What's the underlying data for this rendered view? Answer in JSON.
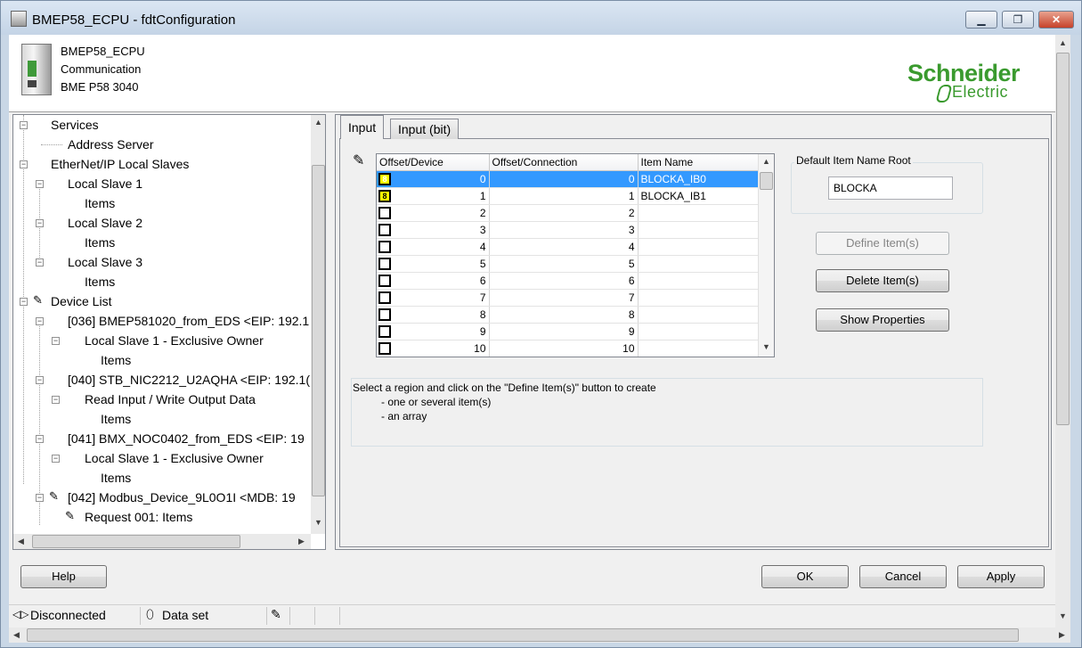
{
  "window": {
    "title": "BMEP58_ECPU - fdtConfiguration"
  },
  "header": {
    "device_name": "BMEP58_ECPU",
    "category": "Communication",
    "model": "BME P58 3040",
    "logo_line1": "Schneider",
    "logo_line2": "Electric"
  },
  "tree": {
    "items": [
      {
        "label": "Services"
      },
      {
        "label": "Address Server"
      },
      {
        "label": "EtherNet/IP Local Slaves"
      },
      {
        "label": "Local Slave 1"
      },
      {
        "label": "Items"
      },
      {
        "label": "Local Slave 2"
      },
      {
        "label": "Items"
      },
      {
        "label": "Local Slave 3"
      },
      {
        "label": "Items"
      },
      {
        "label": "Device List"
      },
      {
        "label": "[036] BMEP581020_from_EDS <EIP: 192.1"
      },
      {
        "label": "Local Slave 1 - Exclusive Owner"
      },
      {
        "label": "Items"
      },
      {
        "label": "[040] STB_NIC2212_U2AQHA <EIP: 192.1("
      },
      {
        "label": "Read Input / Write Output Data"
      },
      {
        "label": "Items"
      },
      {
        "label": "[041] BMX_NOC0402_from_EDS <EIP: 19"
      },
      {
        "label": "Local Slave 1 - Exclusive Owner"
      },
      {
        "label": "Items"
      },
      {
        "label": "[042] Modbus_Device_9L0O1I <MDB: 19"
      },
      {
        "label": "Request 001: Items"
      }
    ]
  },
  "tabs": [
    {
      "label": "Input"
    },
    {
      "label": "Input (bit)"
    }
  ],
  "grid": {
    "columns": [
      "Offset/Device",
      "Offset/Connection",
      "Item Name"
    ],
    "rows": [
      {
        "device": "0",
        "connection": "0",
        "name": "BLOCKA_IB0",
        "mark": "8"
      },
      {
        "device": "1",
        "connection": "1",
        "name": "BLOCKA_IB1",
        "mark": "8"
      },
      {
        "device": "2",
        "connection": "2",
        "name": "",
        "mark": ""
      },
      {
        "device": "3",
        "connection": "3",
        "name": "",
        "mark": ""
      },
      {
        "device": "4",
        "connection": "4",
        "name": "",
        "mark": ""
      },
      {
        "device": "5",
        "connection": "5",
        "name": "",
        "mark": ""
      },
      {
        "device": "6",
        "connection": "6",
        "name": "",
        "mark": ""
      },
      {
        "device": "7",
        "connection": "7",
        "name": "",
        "mark": ""
      },
      {
        "device": "8",
        "connection": "8",
        "name": "",
        "mark": ""
      },
      {
        "device": "9",
        "connection": "9",
        "name": "",
        "mark": ""
      },
      {
        "device": "10",
        "connection": "10",
        "name": "",
        "mark": ""
      }
    ]
  },
  "name_root": {
    "label": "Default Item Name Root",
    "value": "BLOCKA"
  },
  "buttons": {
    "define": "Define Item(s)",
    "delete": "Delete Item(s)",
    "show_props": "Show Properties",
    "help": "Help",
    "ok": "OK",
    "cancel": "Cancel",
    "apply": "Apply"
  },
  "info": {
    "line1": "Select a region and click on the \"Define Item(s)\" button to create",
    "line2": "- one or several item(s)",
    "line3": "- an array"
  },
  "status": {
    "connection": "Disconnected",
    "dataset": "Data set"
  }
}
